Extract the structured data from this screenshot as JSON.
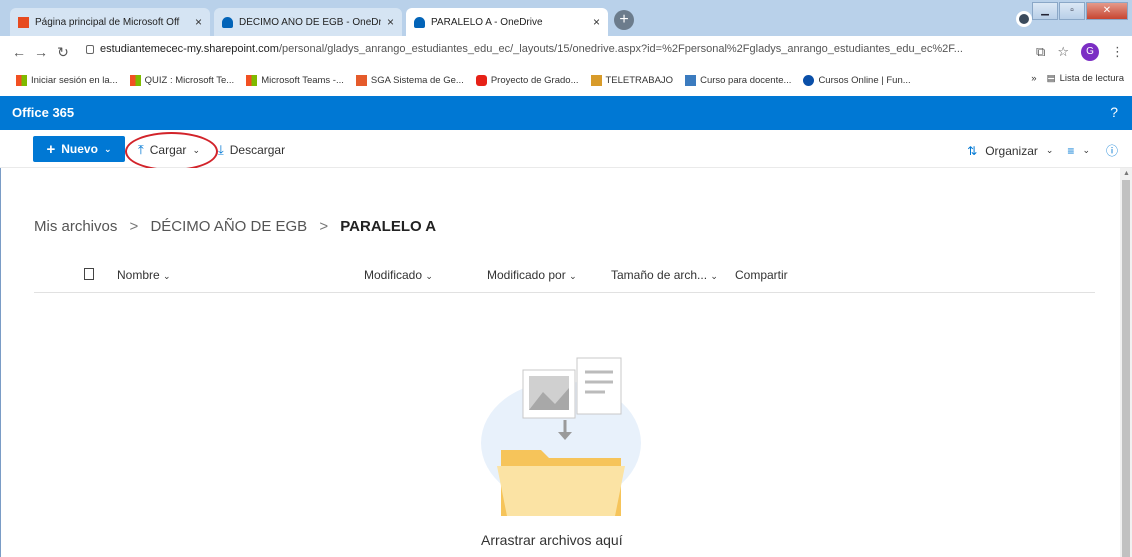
{
  "browser": {
    "tabs": [
      {
        "title": "Página principal de Microsoft Off",
        "close": "×"
      },
      {
        "title": "DÉCIMO AÑO DE EGB - OneDrive",
        "close": "×"
      },
      {
        "title": "PARALELO A - OneDrive",
        "close": "×"
      }
    ],
    "new_tab_label": "+",
    "url_host": "estudiantemecec-my.sharepoint.com",
    "url_path": "/personal/gladys_anrango_estudiantes_edu_ec/_layouts/15/onedrive.aspx?id=%2Fpersonal%2Fgladys_anrango_estudiantes_edu_ec%2F...",
    "profile_initial": "G",
    "bookmarks": [
      "Iniciar sesión en la...",
      "QUIZ : Microsoft Te...",
      "Microsoft Teams -...",
      "SGA Sistema de Ge...",
      "Proyecto de Grado...",
      "TELETRABAJO",
      "Curso para docente...",
      "Cursos Online | Fun..."
    ],
    "bookmarks_overflow": "»",
    "reading_list": "Lista de lectura"
  },
  "suite": {
    "brand": "Office 365",
    "help": "?"
  },
  "commands": {
    "new_label": "Nuevo",
    "upload_label": "Cargar",
    "download_label": "Descargar",
    "sort_label": "Organizar"
  },
  "breadcrumb": {
    "root": "Mis archivos",
    "parent": "DÉCIMO AÑO DE EGB",
    "current": "PARALELO A",
    "separator": ">"
  },
  "columns": {
    "name": "Nombre",
    "modified": "Modificado",
    "modified_by": "Modificado por",
    "size": "Tamaño de arch...",
    "share": "Compartir"
  },
  "empty": {
    "message": "Arrastrar archivos aquí"
  },
  "colors": {
    "accent": "#0078d4",
    "highlight": "#d2232a",
    "tabstrip": "#b9d1ea"
  }
}
